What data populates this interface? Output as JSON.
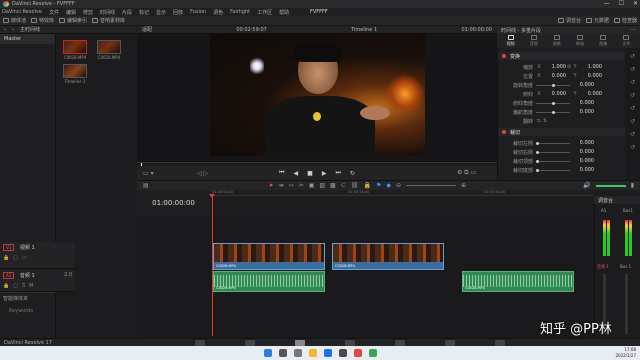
{
  "window": {
    "title": "DaVinci Resolve - FVFFFF",
    "controls": [
      "—",
      "☐",
      "✕"
    ]
  },
  "menu": {
    "items": [
      "DaVinci Resolve",
      "文件",
      "编辑",
      "修剪",
      "时间线",
      "片段",
      "标记",
      "显示",
      "回放",
      "Fusion",
      "调色",
      "Fairlight",
      "工作区",
      "帮助"
    ],
    "project": "FVFFFF"
  },
  "toolbar": {
    "left": [
      "媒体池",
      "特效库",
      "编辑索引",
      "音响素材库"
    ],
    "right": [
      "调音台",
      "元数据",
      "检查器"
    ]
  },
  "media_pool": {
    "header": [
      "主时间线"
    ],
    "bins": [
      "Master"
    ],
    "clips": [
      {
        "name": "C0028.MP4",
        "selected": true
      },
      {
        "name": "C0028.MP4",
        "selected": false
      },
      {
        "name": "Timeline 1",
        "selected": false
      }
    ],
    "smart_bins": "智能媒体夹",
    "keywords": "Keywords"
  },
  "viewer": {
    "zoom": "适配",
    "timecode_left": "00:02:59:07",
    "timeline_name": "Timeline 1",
    "timecode_right": "01:00:00:00"
  },
  "transport": {
    "buttons": [
      "⏮",
      "◀",
      "■",
      "▶",
      "⏭",
      "↻"
    ]
  },
  "inspector": {
    "title": "时间线 - 多重片段",
    "tabs": [
      "视频",
      "音频",
      "效果",
      "转场",
      "图像",
      "文件"
    ],
    "transform_label": "变换",
    "crop_label": "裁切",
    "rows": [
      {
        "label": "缩放",
        "x": "1.000",
        "y": "1.000"
      },
      {
        "label": "位置",
        "x": "0.000",
        "y": "0.000"
      },
      {
        "label": "旋转角度",
        "x": "0.000"
      },
      {
        "label": "俯仰",
        "x": "0.000",
        "y": "0.000"
      },
      {
        "label": "俯仰角度",
        "x": "0.000"
      },
      {
        "label": "偏航角度",
        "x": "0.000"
      },
      {
        "label": "翻转",
        "x": ""
      }
    ],
    "crop_rows": [
      {
        "label": "裁切左侧",
        "x": "0.000"
      },
      {
        "label": "裁切右侧",
        "x": "0.000"
      },
      {
        "label": "裁切顶部",
        "x": "0.000"
      },
      {
        "label": "裁切底部",
        "x": "0.000"
      },
      {
        "label": "柔化",
        "x": "0.000"
      }
    ]
  },
  "timeline": {
    "timecode": "01:00:00:00",
    "ruler": [
      "01:00:00:00",
      "01:00:15:00",
      "01:00:30:00"
    ],
    "video_track": {
      "id": "V1",
      "name": "视频 1"
    },
    "audio_track": {
      "id": "A1",
      "name": "音频 1",
      "level": "2.0"
    },
    "video_clip_label": "C0028.MP4",
    "audio_clip_label": "C0028.MP4"
  },
  "mixer": {
    "title": "调音台",
    "channels": [
      "A1",
      "Bus1"
    ],
    "labels": [
      "音频 1",
      "Bus 1"
    ]
  },
  "page_bar": {
    "app": "DaVinci Resolve 17"
  },
  "taskbar": {
    "time": "17:08",
    "date": "2022/1/27"
  },
  "watermark": "知乎 @PP林",
  "colors": {
    "accent": "#e33333",
    "video_clip": "#3b6ea0",
    "audio_clip": "#2f8a52"
  }
}
